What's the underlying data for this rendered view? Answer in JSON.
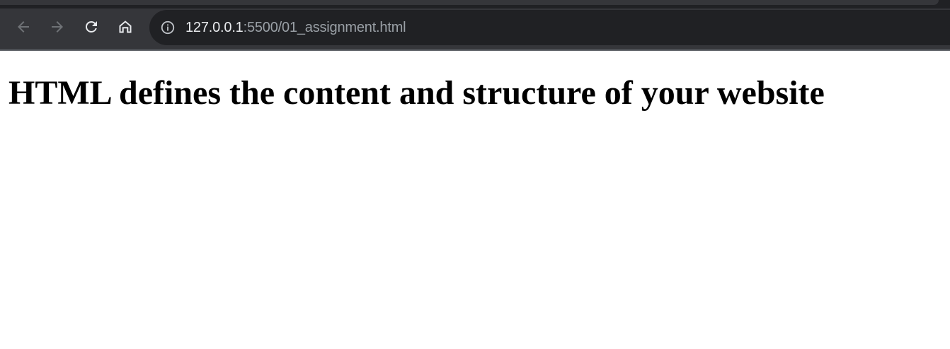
{
  "browser": {
    "address_bar": {
      "url_host": "127.0.0.1",
      "url_rest": ":5500/01_assignment.html"
    },
    "icons": {
      "back": "arrow-left",
      "forward": "arrow-right",
      "reload": "reload",
      "home": "home",
      "site_info": "info-circle"
    },
    "colors": {
      "toolbar": "#35363a",
      "omnibox": "#202124",
      "icon": "#e8eaed",
      "icon_disabled": "#6f7276",
      "url_host": "#e8eaed",
      "url_rest": "#9aa0a6"
    }
  },
  "page": {
    "heading": "HTML defines the content and structure of your website"
  }
}
